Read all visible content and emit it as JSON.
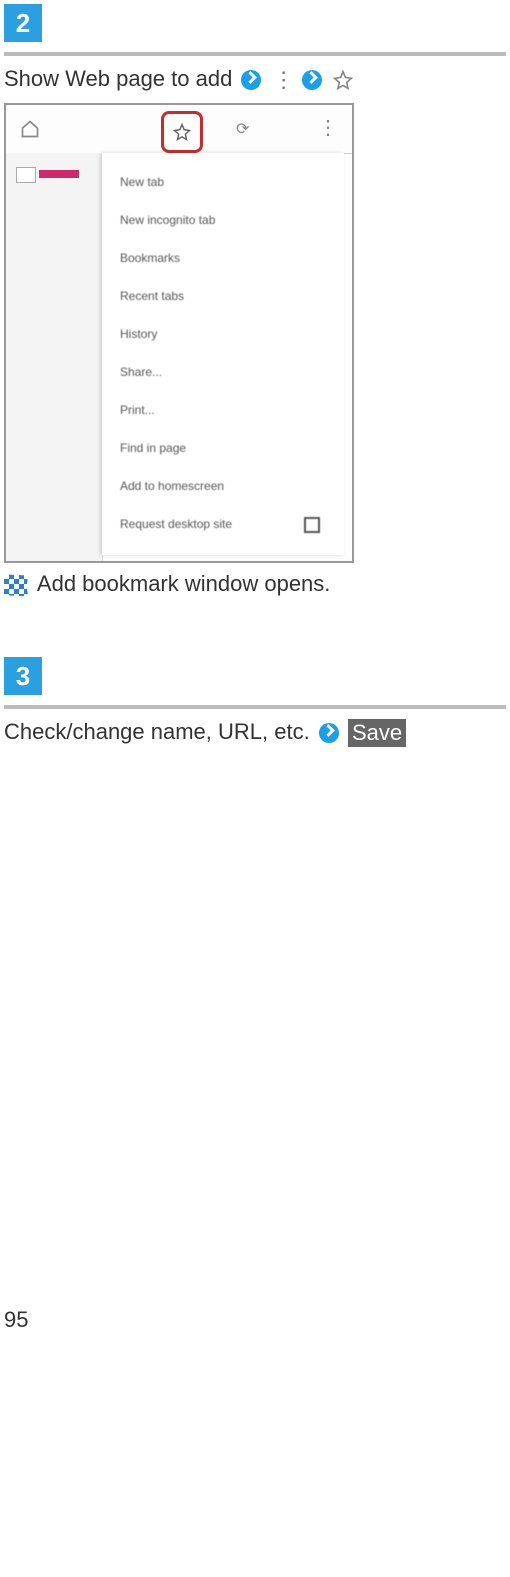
{
  "step2": {
    "number": "2",
    "text": "Show Web page to add",
    "result": "Add bookmark window opens."
  },
  "screenshot_menu": {
    "items": [
      "New tab",
      "New incognito tab",
      "Bookmarks",
      "Recent tabs",
      "History",
      "Share...",
      "Print...",
      "Find in page",
      "Add to homescreen",
      "Request desktop site"
    ]
  },
  "step3": {
    "number": "3",
    "text": "Check/change name, URL, etc.",
    "save": "Save"
  },
  "page_number": "95"
}
